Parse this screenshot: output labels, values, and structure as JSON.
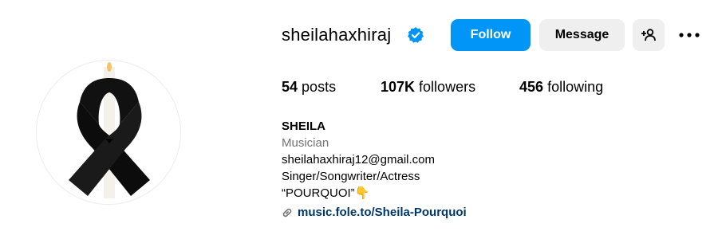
{
  "profile": {
    "username": "sheilahaxhiraj",
    "verified": true,
    "accent_color": "#0095f6",
    "buttons": {
      "follow_label": "Follow",
      "message_label": "Message",
      "add_user_icon": "person-add-icon",
      "more_icon": "more-options-icon"
    },
    "stats": {
      "posts_count": "54",
      "posts_label": "posts",
      "followers_count": "107K",
      "followers_label": "followers",
      "following_count": "456",
      "following_label": "following"
    },
    "bio": {
      "name": "SHEILA",
      "category": "Musician",
      "email": "sheilahaxhiraj12@gmail.com",
      "tagline": "Singer/Songwriter/Actress",
      "quote": "“POURQUOI”👇",
      "link_text": "music.fole.to/Sheila-Pourquoi",
      "link_icon": "link-icon"
    },
    "avatar": {
      "description_icon": "mourning-ribbon-icon"
    }
  }
}
